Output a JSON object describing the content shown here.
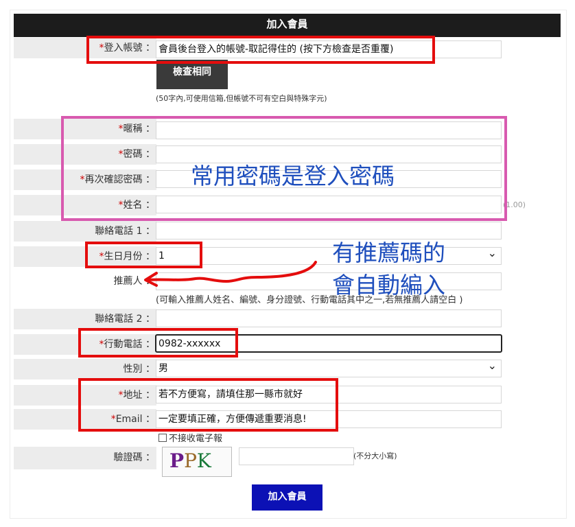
{
  "form": {
    "title": "加入會員",
    "login_account": {
      "label": "登入帳號",
      "value": "會員後台登入的帳號-取記得住的 (按下方檢查是否重覆)"
    },
    "check_button": "檢查相同",
    "account_hint": "(50字內,可使用信箱,但帳號不可有空白與特殊字元)",
    "nickname": {
      "label": "暱稱",
      "value": ""
    },
    "password": {
      "label": "密碼",
      "value": ""
    },
    "confirm_password": {
      "label": "再次確認密碼",
      "value": ""
    },
    "name": {
      "label": "姓名",
      "value": "",
      "suffix": "(1.00)"
    },
    "phone1": {
      "label": "聯絡電話 1",
      "value": ""
    },
    "birth_month": {
      "label": "生日月份",
      "value": "1"
    },
    "referrer": {
      "label": "推薦人",
      "value": "",
      "hint": "(可輸入推薦人姓名、編號、身分證號、行動電話其中之一,若無推薦人請空白 )"
    },
    "phone2": {
      "label": "聯絡電話 2",
      "value": ""
    },
    "mobile": {
      "label": "行動電話",
      "value": "0982-xxxxxx"
    },
    "gender": {
      "label": "性別",
      "value": "男"
    },
    "address": {
      "label": "地址",
      "value": "若不方便寫，請填住那一縣市就好"
    },
    "email": {
      "label": "Email",
      "value": "一定要填正確，方便傳遞重要消息!"
    },
    "no_newsletter": "不接收電子報",
    "captcha": {
      "label": "驗證碼",
      "image_text": "PPK",
      "hint": "(不分大小寫)"
    },
    "submit": "加入會員",
    "colon": "："
  },
  "annotations": {
    "password_note": "常用密碼是登入密碼",
    "referral_note_line1": "有推薦碼的",
    "referral_note_line2": "會自動編入"
  },
  "colors": {
    "title_bg": "#1c1c1c",
    "submit_bg": "#0c11b5",
    "highlight_red": "#e40d0d",
    "highlight_pink": "#d85aaf",
    "annotation_blue": "#1f4fbd"
  }
}
